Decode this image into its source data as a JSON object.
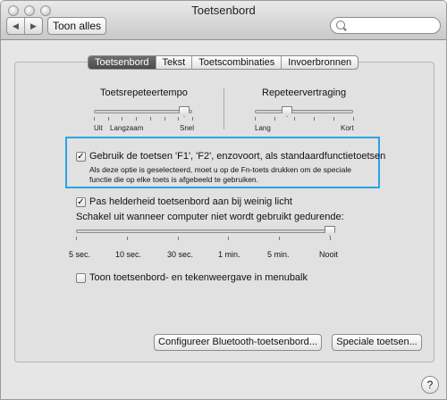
{
  "window": {
    "title": "Toetsenbord"
  },
  "toolbar": {
    "back_glyph": "◀",
    "forward_glyph": "▶",
    "show_all_label": "Toon alles",
    "search_placeholder": ""
  },
  "tabs": [
    {
      "label": "Toetsenbord",
      "active": true
    },
    {
      "label": "Tekst",
      "active": false
    },
    {
      "label": "Toetscombinaties",
      "active": false
    },
    {
      "label": "Invoerbronnen",
      "active": false
    }
  ],
  "key_repeat": {
    "title": "Toetsrepeteertempo",
    "labels": [
      "Uit",
      "Langzaam",
      "Snel"
    ],
    "value_fraction": 0.92
  },
  "repeat_delay": {
    "title": "Repeteervertraging",
    "labels": [
      "Lang",
      "Kort"
    ],
    "value_fraction": 0.33
  },
  "fn_keys": {
    "checked": true,
    "label": "Gebruik de toetsen 'F1', 'F2', enzovoort, als standaardfunctietoetsen",
    "description_line1": "Als deze optie is geselecteerd, moet u op de Fn-toets drukken om de speciale",
    "description_line2": "functie die op elke toets is afgebeeld te gebruiken."
  },
  "brightness": {
    "checked": true,
    "label": "Pas helderheid toetsenbord aan bij weinig licht",
    "off_label": "Schakel uit wanneer computer niet wordt gebruikt gedurende:",
    "ticks": [
      "5 sec.",
      "10 sec.",
      "30 sec.",
      "1 min.",
      "5 min.",
      "Nooit"
    ],
    "value_fraction": 1.0
  },
  "menu_bar_viewer": {
    "checked": false,
    "label": "Toon toetsenbord- en tekenweergave in menubalk"
  },
  "buttons": {
    "bluetooth": "Configureer Bluetooth-toetsenbord...",
    "modifier": "Speciale toetsen..."
  },
  "help_glyph": "?",
  "check_glyph": "✓"
}
